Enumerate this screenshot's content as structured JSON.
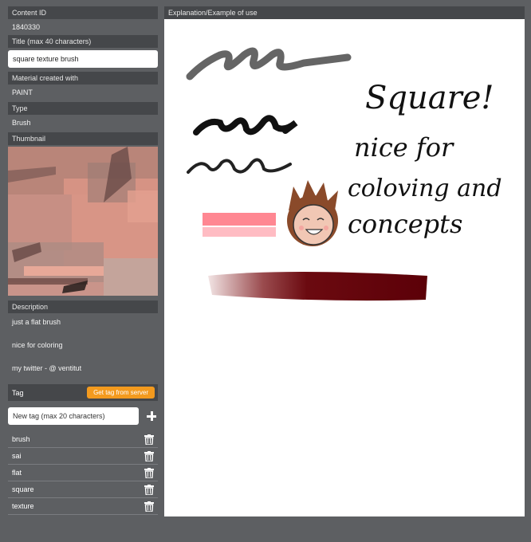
{
  "content_id": {
    "label": "Content ID",
    "value": "1840330"
  },
  "title": {
    "label": "Title (max 40 characters)",
    "value": "square texture brush"
  },
  "material": {
    "label": "Material created with",
    "value": "PAINT"
  },
  "type": {
    "label": "Type",
    "value": "Brush"
  },
  "thumbnail": {
    "label": "Thumbnail"
  },
  "description": {
    "label": "Description",
    "lines": [
      "just a flat brush",
      "nice for coloring",
      "my twitter - @ ventitut"
    ]
  },
  "tag": {
    "label": "Tag",
    "server_button": "Get tag from server",
    "new_tag_placeholder": "New tag (max 20 characters)",
    "items": [
      "brush",
      "sai",
      "flat",
      "square",
      "texture"
    ]
  },
  "explanation": {
    "label": "Explanation/Example of use",
    "handwriting": [
      "Square!",
      "nice for",
      "coloving and",
      "concepts"
    ]
  },
  "colors": {
    "accent": "#f39a1e",
    "header": "#45474a",
    "panel": "#5d5f62"
  }
}
